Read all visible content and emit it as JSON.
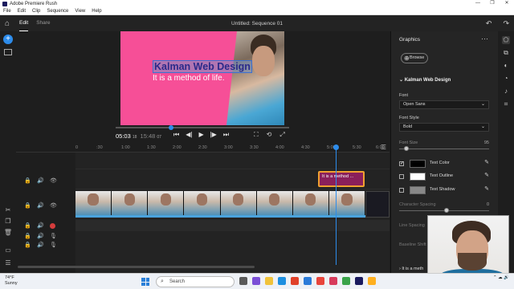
{
  "window": {
    "title": "Adobe Premiere Rush",
    "controls": [
      "—",
      "❐",
      "✕"
    ]
  },
  "menu": [
    "File",
    "Edit",
    "Clip",
    "Sequence",
    "View",
    "Help"
  ],
  "header": {
    "tabs": [
      {
        "label": "Edit",
        "active": true
      },
      {
        "label": "Share",
        "active": false
      }
    ],
    "sequence_title": "Untitled: Sequence 01"
  },
  "monitor": {
    "title_line": "Kalman Web Design",
    "subtitle_line": "It is a method of life.",
    "timecode": "05:03",
    "timecode_frames": "18",
    "duration": "15:48",
    "duration_frames": "07"
  },
  "timeline": {
    "ruler_ticks": [
      "0",
      ":30",
      "1:00",
      "1:30",
      "2:00",
      "2:30",
      "3:00",
      "3:30",
      "4:00",
      "4:30",
      "5:00",
      "5:30",
      "6:00"
    ],
    "title_clip_label": "It is a method ..."
  },
  "graphics_panel": {
    "title": "Graphics",
    "browse_label": "Browse",
    "section_title": "Kalman Web Design",
    "font_label": "Font",
    "font_value": "Open Sans",
    "font_style_label": "Font Style",
    "font_style_value": "Bold",
    "font_size_label": "Font Size",
    "font_size_value": "95",
    "options": [
      {
        "label": "Text Color",
        "checked": true,
        "swatch": "#000000"
      },
      {
        "label": "Text Outline",
        "checked": false,
        "swatch": "#ffffff"
      },
      {
        "label": "Text Shadow",
        "checked": false,
        "swatch": "#888888"
      }
    ],
    "character_spacing_label": "Character Spacing",
    "character_spacing_value": "0",
    "line_spacing_label": "Line Spacing",
    "baseline_shift_label": "Baseline Shift",
    "bottom_section": "It is a meth"
  },
  "taskbar": {
    "temperature": "74°F",
    "condition": "Sunny",
    "search_placeholder": "Search"
  },
  "colors": {
    "accent": "#2d8ceb",
    "video_bg": "#f64f97",
    "title_clip": "#8a1f5a",
    "title_clip_border": "#f0a030",
    "record": "#d43c3c"
  }
}
